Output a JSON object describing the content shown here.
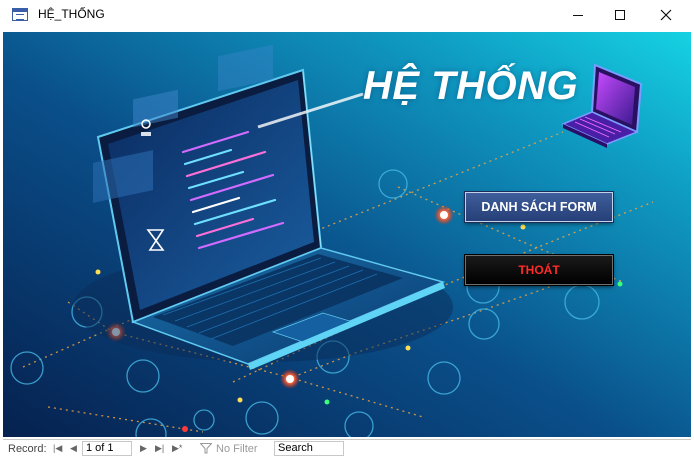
{
  "window": {
    "title": "HỆ_THỐNG"
  },
  "form": {
    "heading": "HỆ THỐNG",
    "buttons": {
      "list_forms": "DANH SÁCH FORM",
      "exit": "THOÁT"
    },
    "colors": {
      "background_dark": "#0a3470",
      "background_light": "#12c3d8",
      "list_button": "#2f4f8c",
      "exit_button": "#000000",
      "exit_text": "#ff2a2a"
    }
  },
  "record_nav": {
    "label": "Record:",
    "first_icon": "first-record-icon",
    "prev_icon": "previous-record-icon",
    "position": "1 of 1",
    "next_icon": "next-record-icon",
    "last_icon": "last-record-icon",
    "new_icon": "new-record-icon",
    "filter_icon": "filter-icon",
    "filter_status": "No Filter",
    "search_placeholder": "Search"
  }
}
